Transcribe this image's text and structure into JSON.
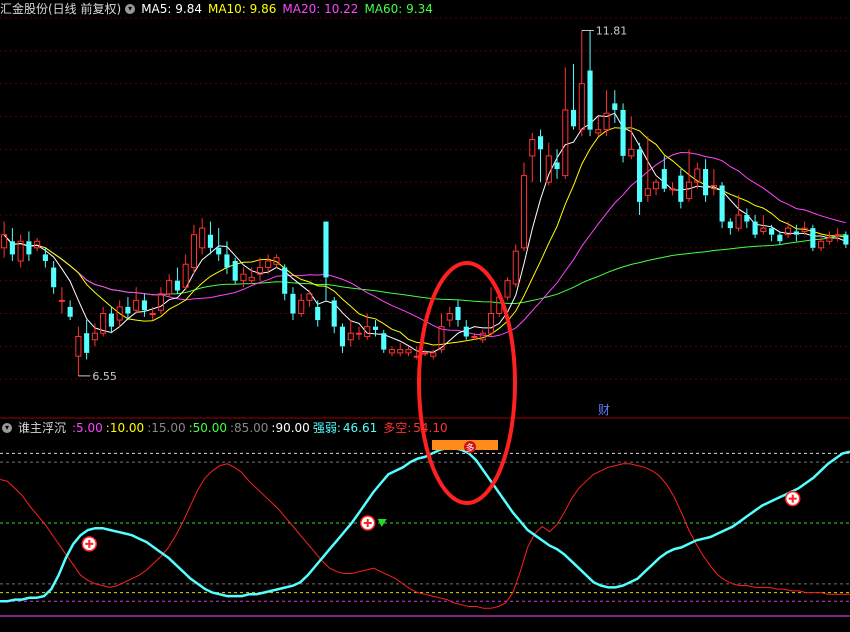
{
  "header": {
    "stock_title": "汇金股份(日线 前复权)",
    "ma": [
      {
        "label": "MA5:",
        "value": "9.84",
        "color": "#ffffff"
      },
      {
        "label": "MA10:",
        "value": "9.86",
        "color": "#ffff00"
      },
      {
        "label": "MA20:",
        "value": "10.22",
        "color": "#ff44ff"
      },
      {
        "label": "MA60:",
        "value": "9.34",
        "color": "#44ff44"
      }
    ]
  },
  "indicator": {
    "name": "谁主浮沉",
    "levels": [
      {
        "value": "5.00",
        "color": "#ff44ff"
      },
      {
        "value": "10.00",
        "color": "#ffff00"
      },
      {
        "value": "15.00",
        "color": "#888888"
      },
      {
        "value": "50.00",
        "color": "#44ff44"
      },
      {
        "value": "85.00",
        "color": "#888888"
      },
      {
        "value": "90.00",
        "color": "#ffffff"
      }
    ],
    "strong_label": "强弱:",
    "strong_value": "46.61",
    "longshort_label": "多空:",
    "longshort_value": "54.10",
    "signal_text": "多"
  },
  "annotations": {
    "high_label": "11.81",
    "low_label": "6.55",
    "cai_label": "财"
  },
  "chart_data": [
    {
      "type": "candlestick",
      "title": "汇金股份(日线 前复权)",
      "ylim": [
        6.0,
        12.0
      ],
      "colors": {
        "up": "#ff3232",
        "down": "#54ffff",
        "ma5": "#ffffff",
        "ma10": "#ffff00",
        "ma20": "#ff44ff",
        "ma60": "#44ff44"
      },
      "candles": [
        [
          8.5,
          8.7,
          8.9,
          8.35
        ],
        [
          8.6,
          8.4,
          8.8,
          8.3
        ],
        [
          8.3,
          8.6,
          8.7,
          8.2
        ],
        [
          8.6,
          8.4,
          8.75,
          8.3
        ],
        [
          8.5,
          8.6,
          8.65,
          8.45
        ],
        [
          8.4,
          8.3,
          8.5,
          8.2
        ],
        [
          8.2,
          7.9,
          8.3,
          7.8
        ],
        [
          7.7,
          7.7,
          7.9,
          7.5
        ],
        [
          7.6,
          7.45,
          7.7,
          7.4
        ],
        [
          6.85,
          7.15,
          7.3,
          6.55
        ],
        [
          7.2,
          6.9,
          7.4,
          6.8
        ],
        [
          7.1,
          7.2,
          7.35,
          7.0
        ],
        [
          7.2,
          7.5,
          7.6,
          7.15
        ],
        [
          7.5,
          7.3,
          7.6,
          7.2
        ],
        [
          7.4,
          7.6,
          7.7,
          7.3
        ],
        [
          7.6,
          7.5,
          7.75,
          7.4
        ],
        [
          7.55,
          7.7,
          7.9,
          7.5
        ],
        [
          7.7,
          7.55,
          7.8,
          7.45
        ],
        [
          7.5,
          7.5,
          7.6,
          7.4
        ],
        [
          7.55,
          7.8,
          7.9,
          7.5
        ],
        [
          7.8,
          8.0,
          8.1,
          7.75
        ],
        [
          8.0,
          7.85,
          8.2,
          7.8
        ],
        [
          7.9,
          8.25,
          8.4,
          7.85
        ],
        [
          8.2,
          8.7,
          8.85,
          8.1
        ],
        [
          8.5,
          8.8,
          8.95,
          8.4
        ],
        [
          8.7,
          8.5,
          8.9,
          8.4
        ],
        [
          8.5,
          8.4,
          8.8,
          8.3
        ],
        [
          8.4,
          8.2,
          8.6,
          8.1
        ],
        [
          8.3,
          8.0,
          8.35,
          7.95
        ],
        [
          8.0,
          8.1,
          8.2,
          7.9
        ],
        [
          8.0,
          8.05,
          8.2,
          7.95
        ],
        [
          8.1,
          8.2,
          8.35,
          8.0
        ],
        [
          8.2,
          8.3,
          8.4,
          8.1
        ],
        [
          8.25,
          8.35,
          8.4,
          8.2
        ],
        [
          8.2,
          7.8,
          8.25,
          7.7
        ],
        [
          7.8,
          7.5,
          7.9,
          7.4
        ],
        [
          7.5,
          7.7,
          7.8,
          7.45
        ],
        [
          7.7,
          7.8,
          7.85,
          7.6
        ],
        [
          7.6,
          7.4,
          7.7,
          7.3
        ],
        [
          8.9,
          8.05,
          8.9,
          7.7
        ],
        [
          7.7,
          7.3,
          7.75,
          7.2
        ],
        [
          7.3,
          7.0,
          7.35,
          6.9
        ],
        [
          7.1,
          7.2,
          7.4,
          7.0
        ],
        [
          7.2,
          7.2,
          7.3,
          7.1
        ],
        [
          7.15,
          7.3,
          7.5,
          7.1
        ],
        [
          7.3,
          7.25,
          7.4,
          7.15
        ],
        [
          7.2,
          6.95,
          7.25,
          6.9
        ],
        [
          6.9,
          6.95,
          7.0,
          6.85
        ],
        [
          6.9,
          6.95,
          7.05,
          6.85
        ],
        [
          6.9,
          6.95,
          7.0,
          6.85
        ],
        [
          6.85,
          6.85,
          7.0,
          6.8
        ],
        [
          6.9,
          6.9,
          6.95,
          6.85
        ],
        [
          6.85,
          6.9,
          6.95,
          6.8
        ],
        [
          6.95,
          7.3,
          7.5,
          6.9
        ],
        [
          7.4,
          7.5,
          7.6,
          7.3
        ],
        [
          7.6,
          7.4,
          7.7,
          7.3
        ],
        [
          7.3,
          7.15,
          7.4,
          7.1
        ],
        [
          7.15,
          7.15,
          7.2,
          7.1
        ],
        [
          7.1,
          7.2,
          7.25,
          7.05
        ],
        [
          7.2,
          7.5,
          7.9,
          7.15
        ],
        [
          7.5,
          7.75,
          7.8,
          7.45
        ],
        [
          7.75,
          8.0,
          8.05,
          7.7
        ],
        [
          7.95,
          8.45,
          8.55,
          7.9
        ],
        [
          8.5,
          9.6,
          9.8,
          8.45
        ],
        [
          9.9,
          10.15,
          10.25,
          9.5
        ],
        [
          10.2,
          10.0,
          10.3,
          9.5
        ],
        [
          9.5,
          9.9,
          10.1,
          9.45
        ],
        [
          9.8,
          9.7,
          10.0,
          9.55
        ],
        [
          9.6,
          10.6,
          11.25,
          9.55
        ],
        [
          10.6,
          10.35,
          11.3,
          10.3
        ],
        [
          10.3,
          11.0,
          11.81,
          10.2
        ],
        [
          11.2,
          10.3,
          11.8,
          10.2
        ],
        [
          10.25,
          10.3,
          10.5,
          10.2
        ],
        [
          10.3,
          10.55,
          10.9,
          10.2
        ],
        [
          10.7,
          10.6,
          10.9,
          10.4
        ],
        [
          10.6,
          9.9,
          10.7,
          9.8
        ],
        [
          9.9,
          10.0,
          10.5,
          9.85
        ],
        [
          10.0,
          9.2,
          10.1,
          9.0
        ],
        [
          9.3,
          9.4,
          10.2,
          9.2
        ],
        [
          9.4,
          9.5,
          9.55,
          9.3
        ],
        [
          9.7,
          9.4,
          9.9,
          9.35
        ],
        [
          9.4,
          9.4,
          9.5,
          9.3
        ],
        [
          9.6,
          9.2,
          9.7,
          9.1
        ],
        [
          9.25,
          9.5,
          10.0,
          9.2
        ],
        [
          9.5,
          9.7,
          9.8,
          9.4
        ],
        [
          9.7,
          9.3,
          9.85,
          9.2
        ],
        [
          9.4,
          9.45,
          9.7,
          9.3
        ],
        [
          9.45,
          8.9,
          9.5,
          8.8
        ],
        [
          8.9,
          8.8,
          8.95,
          8.7
        ],
        [
          8.8,
          9.0,
          9.3,
          8.75
        ],
        [
          9.0,
          8.9,
          9.1,
          8.8
        ],
        [
          8.9,
          8.7,
          9.0,
          8.65
        ],
        [
          8.75,
          8.8,
          9.0,
          8.7
        ],
        [
          8.8,
          8.7,
          8.85,
          8.6
        ],
        [
          8.7,
          8.6,
          8.75,
          8.55
        ],
        [
          8.7,
          8.8,
          8.9,
          8.65
        ],
        [
          8.75,
          8.7,
          8.85,
          8.6
        ],
        [
          8.75,
          8.8,
          8.9,
          8.7
        ],
        [
          8.8,
          8.5,
          8.85,
          8.45
        ],
        [
          8.5,
          8.6,
          8.7,
          8.45
        ],
        [
          8.6,
          8.65,
          8.75,
          8.55
        ],
        [
          8.7,
          8.7,
          8.8,
          8.6
        ],
        [
          8.7,
          8.55,
          8.75,
          8.5
        ]
      ],
      "high_point": {
        "index": 70,
        "value": 11.81
      },
      "low_point": {
        "index": 9,
        "value": 6.55
      }
    },
    {
      "type": "line",
      "title": "谁主浮沉",
      "ylim": [
        0,
        100
      ],
      "reference_lines": [
        5,
        10,
        15,
        50,
        85,
        90
      ],
      "series": [
        {
          "name": "强弱",
          "color": "#54ffff",
          "values": [
            5,
            5,
            6,
            6,
            7,
            7,
            8,
            12,
            20,
            30,
            38,
            43,
            46,
            47,
            47,
            46,
            45,
            44,
            43,
            41,
            39,
            36,
            33,
            30,
            26,
            22,
            18,
            15,
            12,
            10,
            9,
            8,
            8,
            8,
            9,
            9,
            10,
            11,
            12,
            13,
            14,
            16,
            20,
            25,
            30,
            35,
            40,
            45,
            50,
            56,
            62,
            68,
            73,
            78,
            80,
            82,
            85,
            87,
            88,
            90,
            92,
            93,
            93,
            92,
            90,
            86,
            80,
            74,
            68,
            62,
            56,
            51,
            46,
            43,
            40,
            37,
            35,
            32,
            28,
            24,
            20,
            16,
            14,
            13,
            13,
            14,
            16,
            18,
            22,
            26,
            30,
            33,
            35,
            36,
            38,
            40,
            41,
            42,
            44,
            46,
            48,
            51,
            54,
            57,
            60,
            62,
            64,
            66,
            68,
            70,
            73,
            76,
            80,
            84,
            87,
            90,
            91
          ]
        },
        {
          "name": "多空",
          "color": "#ff2020",
          "values": [
            75,
            74,
            70,
            66,
            60,
            55,
            50,
            44,
            38,
            32,
            26,
            20,
            17,
            15,
            14,
            13,
            14,
            16,
            18,
            20,
            23,
            27,
            31,
            36,
            43,
            51,
            60,
            69,
            76,
            80,
            83,
            84,
            82,
            79,
            74,
            70,
            66,
            62,
            58,
            53,
            48,
            43,
            38,
            33,
            28,
            24,
            22,
            21,
            21,
            22,
            23,
            24,
            22,
            20,
            18,
            15,
            12,
            10,
            9,
            8,
            7,
            6,
            4,
            3,
            2,
            2,
            1,
            1,
            2,
            4,
            10,
            22,
            36,
            44,
            48,
            45,
            49,
            56,
            64,
            70,
            74,
            78,
            80,
            82,
            83,
            84,
            84,
            83,
            82,
            80,
            77,
            72,
            65,
            56,
            46,
            38,
            31,
            25,
            20,
            17,
            15,
            14,
            14,
            13,
            13,
            13,
            12,
            12,
            11,
            11,
            10,
            10,
            10,
            9,
            9,
            9,
            9
          ]
        }
      ],
      "signal_marks": [
        10,
        48,
        106
      ]
    }
  ]
}
